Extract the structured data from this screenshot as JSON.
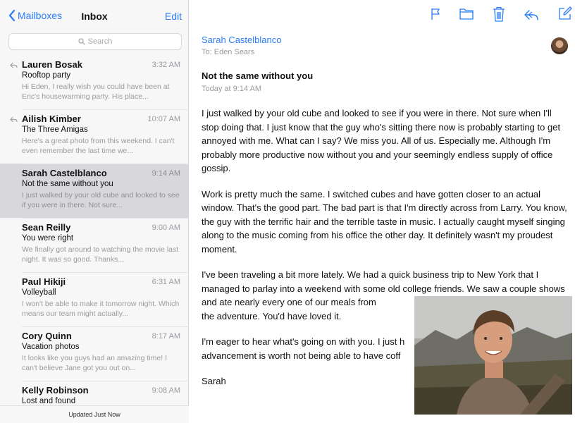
{
  "nav": {
    "back_label": "Mailboxes",
    "title": "Inbox",
    "edit_label": "Edit"
  },
  "search": {
    "placeholder": "Search"
  },
  "messages": [
    {
      "sender": "Lauren Bosak",
      "time": "3:32 AM",
      "subject": "Rooftop party",
      "preview": "Hi Eden, I really wish you could have been at Eric's housewarming party. His place...",
      "replied": true,
      "selected": false
    },
    {
      "sender": "Ailish Kimber",
      "time": "10:07 AM",
      "subject": "The Three Amigas",
      "preview": "Here's a great photo from this weekend. I can't even remember the last time we...",
      "replied": true,
      "selected": false
    },
    {
      "sender": "Sarah Castelblanco",
      "time": "9:14 AM",
      "subject": "Not the same without you",
      "preview": "I just walked by your old cube and looked to see if you were in there. Not sure...",
      "replied": false,
      "selected": true
    },
    {
      "sender": "Sean Reilly",
      "time": "9:00 AM",
      "subject": "You were right",
      "preview": "We finally got around to watching the movie last night. It was so good. Thanks...",
      "replied": false,
      "selected": false
    },
    {
      "sender": "Paul Hikiji",
      "time": "6:31 AM",
      "subject": "Volleyball",
      "preview": "I won't be able to make it tomorrow night. Which means our team might actually...",
      "replied": false,
      "selected": false
    },
    {
      "sender": "Cory Quinn",
      "time": "8:17 AM",
      "subject": "Vacation photos",
      "preview": "It looks like you guys had an amazing time! I can't believe Jane got you out on...",
      "replied": false,
      "selected": false
    },
    {
      "sender": "Kelly Robinson",
      "time": "9:08 AM",
      "subject": "Lost and found",
      "preview": "",
      "replied": false,
      "selected": false
    }
  ],
  "status": {
    "updated": "Updated Just Now"
  },
  "toolbar": {
    "icons": [
      "flag-icon",
      "folder-icon",
      "trash-icon",
      "reply-icon",
      "compose-icon"
    ]
  },
  "message": {
    "from": "Sarah Castelblanco",
    "to": "To: Eden Sears",
    "subject": "Not the same without you",
    "date": "Today at 9:14 AM",
    "paragraphs": [
      "I just walked by your old cube and looked to see if you were in there. Not sure when I'll stop doing that. I just know that the guy who's sitting there now is probably starting to get annoyed with me. What can I say? We miss you. All of us. Especially me. Although I'm probably more productive now without you and your seemingly endless supply of office gossip.",
      "Work is pretty much the same. I switched cubes and have gotten closer to an actual window. That's the good part. The bad part is that I'm directly across from Larry. You know, the guy with the terrific hair and the terrible taste in music. I actually caught myself singing along to the music coming from his office the other day. It definitely wasn't my proudest moment.",
      "I've been traveling a bit more lately. We had a quick business trip to New York that I managed to parlay into a weekend with some old college friends. We saw a couple shows and ate nearly every one of our meals from",
      "the adventure. You'd have loved it.",
      "I'm eager to hear what's going on with you. I just h",
      "advancement is worth not being able to have coff"
    ],
    "signature": "Sarah"
  },
  "colors": {
    "accent": "#2a7cf7",
    "selected_row": "#d8d8dc",
    "muted": "#9a9aa0"
  }
}
